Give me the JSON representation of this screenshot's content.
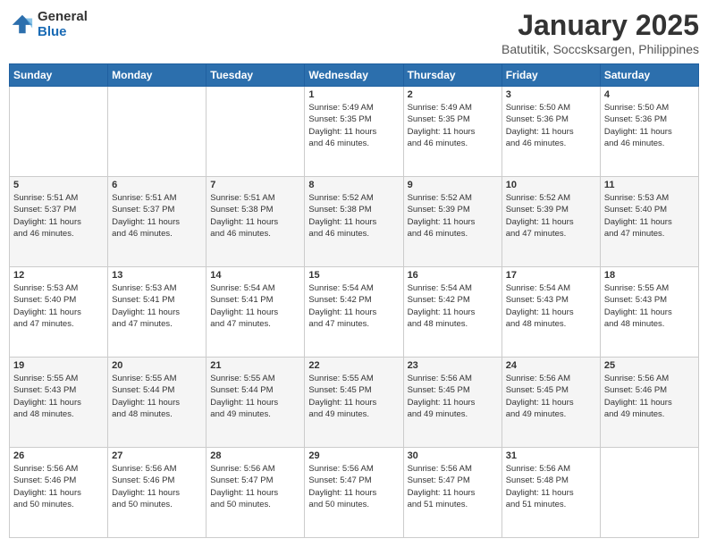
{
  "logo": {
    "general": "General",
    "blue": "Blue"
  },
  "header": {
    "title": "January 2025",
    "subtitle": "Batutitik, Soccsksargen, Philippines"
  },
  "weekdays": [
    "Sunday",
    "Monday",
    "Tuesday",
    "Wednesday",
    "Thursday",
    "Friday",
    "Saturday"
  ],
  "weeks": [
    [
      {
        "day": "",
        "info": ""
      },
      {
        "day": "",
        "info": ""
      },
      {
        "day": "",
        "info": ""
      },
      {
        "day": "1",
        "info": "Sunrise: 5:49 AM\nSunset: 5:35 PM\nDaylight: 11 hours\nand 46 minutes."
      },
      {
        "day": "2",
        "info": "Sunrise: 5:49 AM\nSunset: 5:35 PM\nDaylight: 11 hours\nand 46 minutes."
      },
      {
        "day": "3",
        "info": "Sunrise: 5:50 AM\nSunset: 5:36 PM\nDaylight: 11 hours\nand 46 minutes."
      },
      {
        "day": "4",
        "info": "Sunrise: 5:50 AM\nSunset: 5:36 PM\nDaylight: 11 hours\nand 46 minutes."
      }
    ],
    [
      {
        "day": "5",
        "info": "Sunrise: 5:51 AM\nSunset: 5:37 PM\nDaylight: 11 hours\nand 46 minutes."
      },
      {
        "day": "6",
        "info": "Sunrise: 5:51 AM\nSunset: 5:37 PM\nDaylight: 11 hours\nand 46 minutes."
      },
      {
        "day": "7",
        "info": "Sunrise: 5:51 AM\nSunset: 5:38 PM\nDaylight: 11 hours\nand 46 minutes."
      },
      {
        "day": "8",
        "info": "Sunrise: 5:52 AM\nSunset: 5:38 PM\nDaylight: 11 hours\nand 46 minutes."
      },
      {
        "day": "9",
        "info": "Sunrise: 5:52 AM\nSunset: 5:39 PM\nDaylight: 11 hours\nand 46 minutes."
      },
      {
        "day": "10",
        "info": "Sunrise: 5:52 AM\nSunset: 5:39 PM\nDaylight: 11 hours\nand 47 minutes."
      },
      {
        "day": "11",
        "info": "Sunrise: 5:53 AM\nSunset: 5:40 PM\nDaylight: 11 hours\nand 47 minutes."
      }
    ],
    [
      {
        "day": "12",
        "info": "Sunrise: 5:53 AM\nSunset: 5:40 PM\nDaylight: 11 hours\nand 47 minutes."
      },
      {
        "day": "13",
        "info": "Sunrise: 5:53 AM\nSunset: 5:41 PM\nDaylight: 11 hours\nand 47 minutes."
      },
      {
        "day": "14",
        "info": "Sunrise: 5:54 AM\nSunset: 5:41 PM\nDaylight: 11 hours\nand 47 minutes."
      },
      {
        "day": "15",
        "info": "Sunrise: 5:54 AM\nSunset: 5:42 PM\nDaylight: 11 hours\nand 47 minutes."
      },
      {
        "day": "16",
        "info": "Sunrise: 5:54 AM\nSunset: 5:42 PM\nDaylight: 11 hours\nand 48 minutes."
      },
      {
        "day": "17",
        "info": "Sunrise: 5:54 AM\nSunset: 5:43 PM\nDaylight: 11 hours\nand 48 minutes."
      },
      {
        "day": "18",
        "info": "Sunrise: 5:55 AM\nSunset: 5:43 PM\nDaylight: 11 hours\nand 48 minutes."
      }
    ],
    [
      {
        "day": "19",
        "info": "Sunrise: 5:55 AM\nSunset: 5:43 PM\nDaylight: 11 hours\nand 48 minutes."
      },
      {
        "day": "20",
        "info": "Sunrise: 5:55 AM\nSunset: 5:44 PM\nDaylight: 11 hours\nand 48 minutes."
      },
      {
        "day": "21",
        "info": "Sunrise: 5:55 AM\nSunset: 5:44 PM\nDaylight: 11 hours\nand 49 minutes."
      },
      {
        "day": "22",
        "info": "Sunrise: 5:55 AM\nSunset: 5:45 PM\nDaylight: 11 hours\nand 49 minutes."
      },
      {
        "day": "23",
        "info": "Sunrise: 5:56 AM\nSunset: 5:45 PM\nDaylight: 11 hours\nand 49 minutes."
      },
      {
        "day": "24",
        "info": "Sunrise: 5:56 AM\nSunset: 5:45 PM\nDaylight: 11 hours\nand 49 minutes."
      },
      {
        "day": "25",
        "info": "Sunrise: 5:56 AM\nSunset: 5:46 PM\nDaylight: 11 hours\nand 49 minutes."
      }
    ],
    [
      {
        "day": "26",
        "info": "Sunrise: 5:56 AM\nSunset: 5:46 PM\nDaylight: 11 hours\nand 50 minutes."
      },
      {
        "day": "27",
        "info": "Sunrise: 5:56 AM\nSunset: 5:46 PM\nDaylight: 11 hours\nand 50 minutes."
      },
      {
        "day": "28",
        "info": "Sunrise: 5:56 AM\nSunset: 5:47 PM\nDaylight: 11 hours\nand 50 minutes."
      },
      {
        "day": "29",
        "info": "Sunrise: 5:56 AM\nSunset: 5:47 PM\nDaylight: 11 hours\nand 50 minutes."
      },
      {
        "day": "30",
        "info": "Sunrise: 5:56 AM\nSunset: 5:47 PM\nDaylight: 11 hours\nand 51 minutes."
      },
      {
        "day": "31",
        "info": "Sunrise: 5:56 AM\nSunset: 5:48 PM\nDaylight: 11 hours\nand 51 minutes."
      },
      {
        "day": "",
        "info": ""
      }
    ]
  ]
}
